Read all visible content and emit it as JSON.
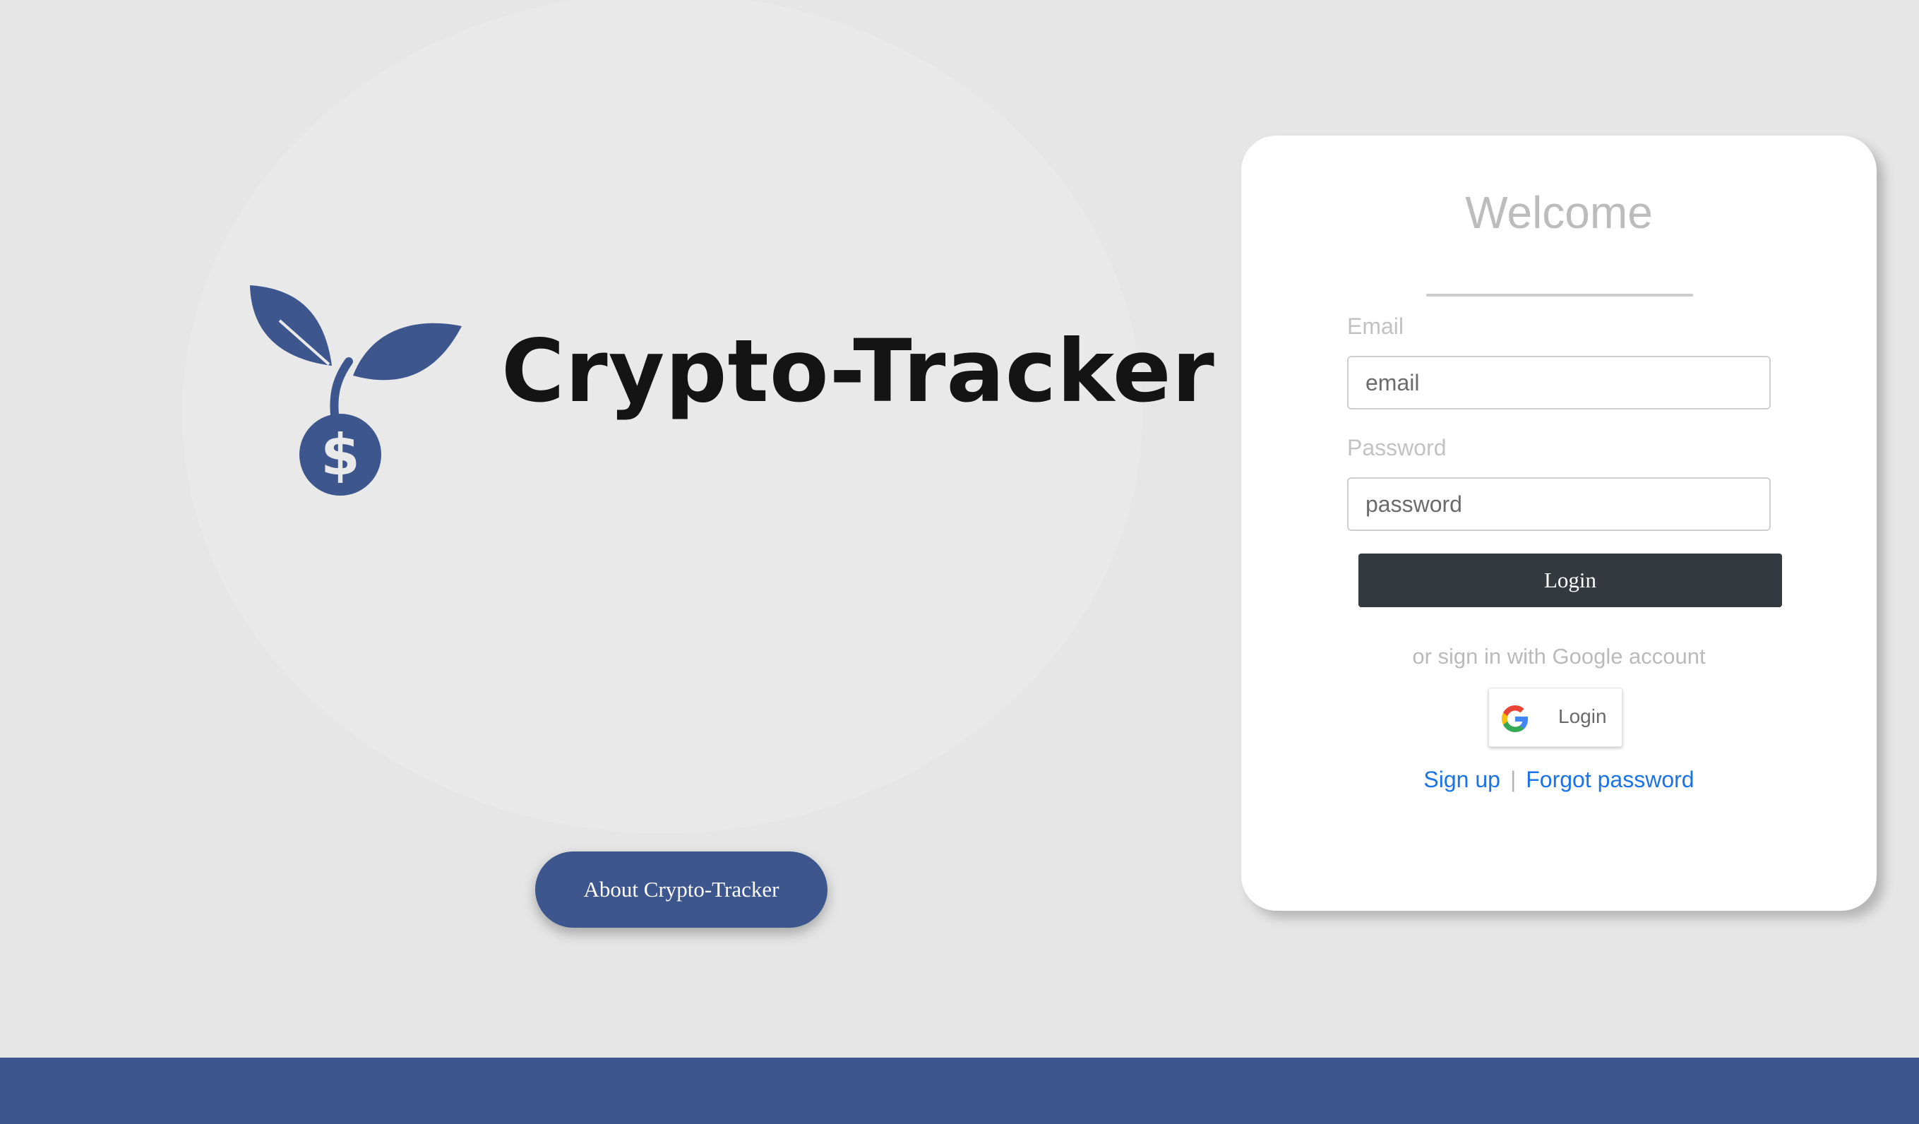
{
  "brand": {
    "name": "Crypto-Tracker",
    "about_button_label": "About Crypto-Tracker",
    "accent_color": "#3d568e",
    "logo_icon": "money-plant-icon"
  },
  "login": {
    "title": "Welcome",
    "email_label": "Email",
    "email_placeholder": "email",
    "password_label": "Password",
    "password_placeholder": "password",
    "login_button_label": "Login",
    "alt_sign_in_text": "or sign in with Google account",
    "google_button_label": "Login",
    "google_icon": "google-g-icon",
    "signup_link": "Sign up",
    "link_separator": "|",
    "forgot_password_link": "Forgot password"
  }
}
